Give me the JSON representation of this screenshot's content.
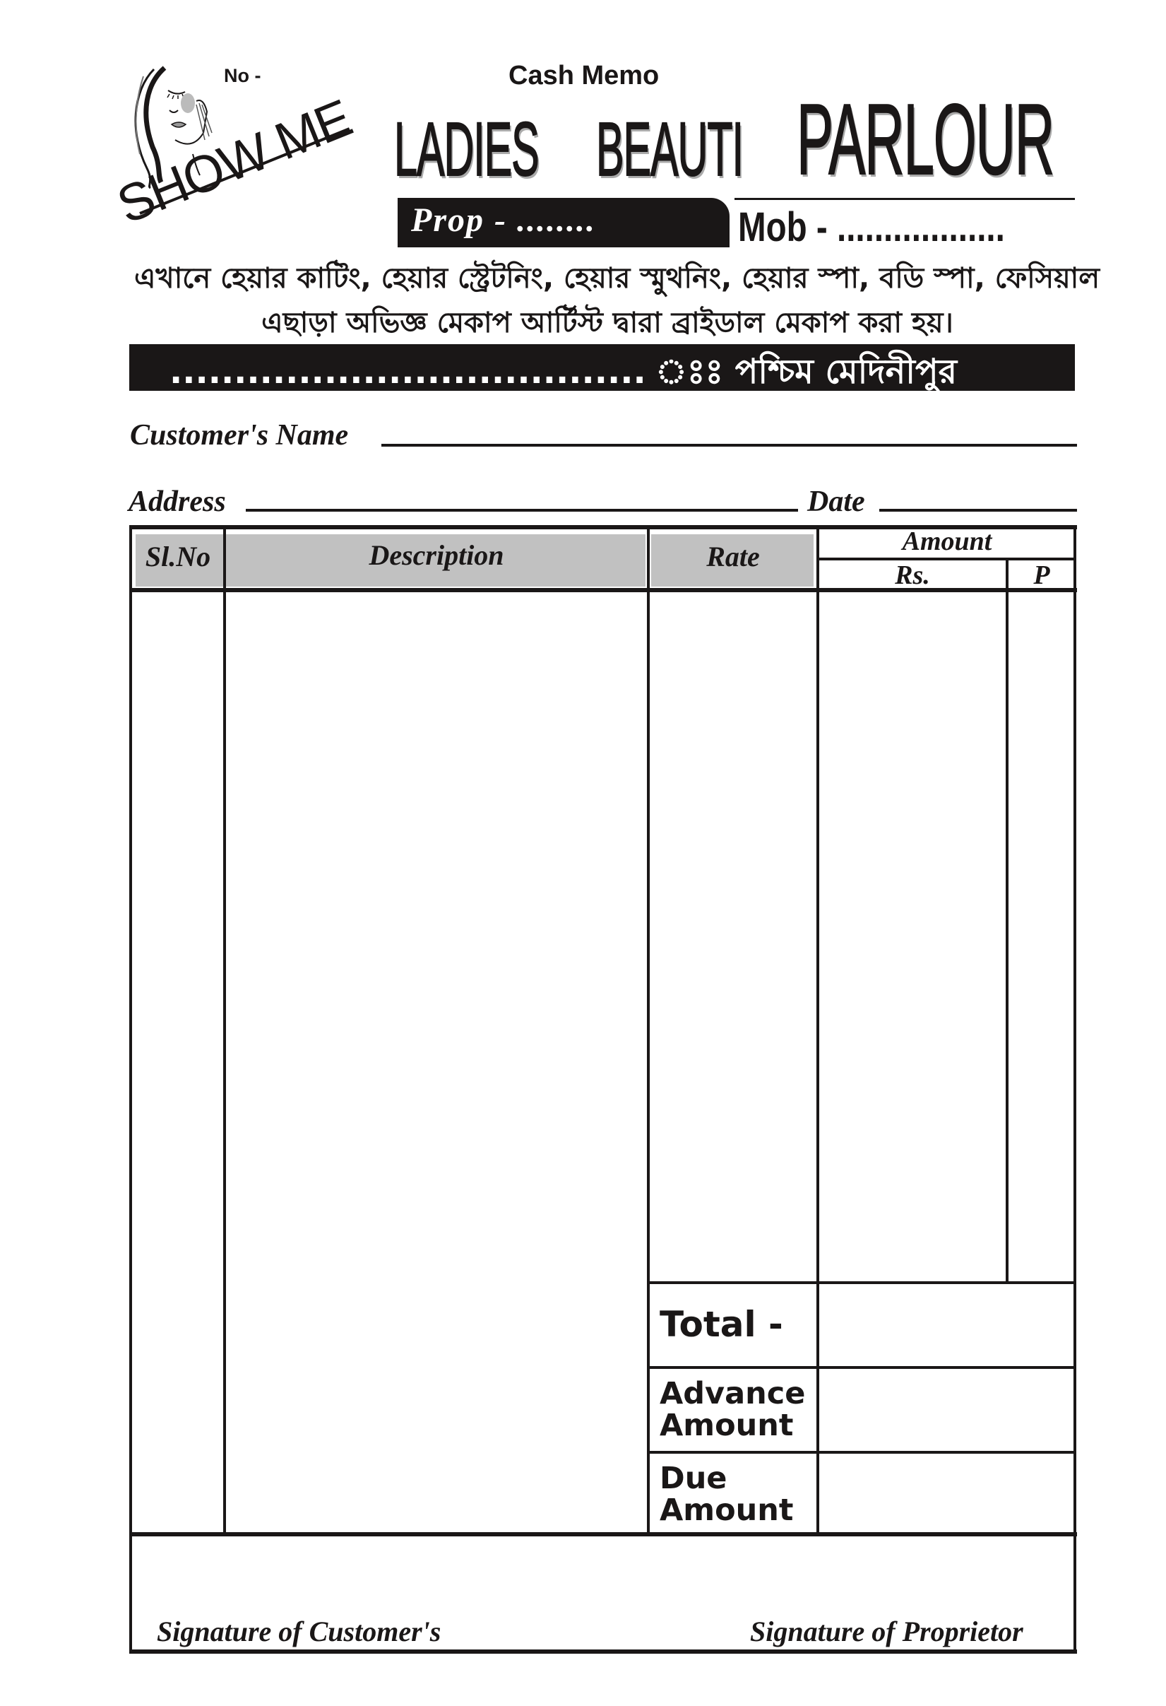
{
  "header": {
    "memo_number_label": "No -",
    "document_type": "Cash Memo",
    "brand_logo_text": "SHOW ME",
    "title_words": [
      "LADIES",
      "BEAUTI",
      "PARLOUR"
    ],
    "proprietor_label": "Prop - ........",
    "mobile_label": "Mob - .................."
  },
  "services": {
    "line_1": "এখানে হেয়ার কাটিং, হেয়ার স্ট্রেটনিং, হেয়ার স্মুথনিং, হেয়ার স্পা, বডি স্পা, ফেসিয়াল",
    "line_2": "এছাড়া অভিজ্ঞ মেকাপ আর্টিস্ট দ্বারা ব্রাইডাল মেকাপ করা হয়।"
  },
  "location_bar": {
    "text": "..................................... ঃঃ পশ্চিম মেদিনীপুর"
  },
  "fields": {
    "customer_name_label": "Customer's Name",
    "address_label": "Address",
    "date_label": "Date"
  },
  "table": {
    "columns": {
      "sl_no": "Sl.No",
      "description": "Description",
      "rate": "Rate",
      "amount": "Amount",
      "rupees": "Rs.",
      "paise": "P"
    },
    "rows": [],
    "totals": {
      "total_label": "Total -",
      "advance_label": "Advance Amount",
      "due_label": "Due Amount"
    }
  },
  "signatures": {
    "customer": "Signature of Customer's",
    "proprietor": "Signature of Proprietor"
  },
  "colors": {
    "ink": "#1a1717",
    "header_shade": "#c1c1c1",
    "paper": "#ffffff"
  }
}
